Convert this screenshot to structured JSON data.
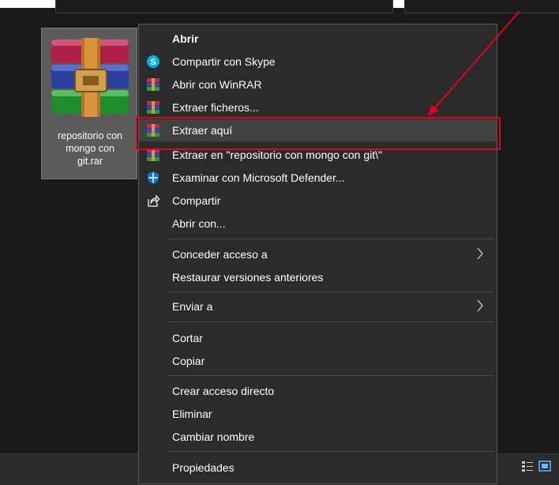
{
  "file": {
    "name": "repositorio con\nmongo con\ngit.rar",
    "icon": "winrar-archive-icon"
  },
  "menu": {
    "items": [
      {
        "label": "Abrir",
        "icon": ""
      },
      {
        "label": "Compartir con Skype",
        "icon": "skype-icon"
      },
      {
        "label": "Abrir con WinRAR",
        "icon": "winrar-icon"
      },
      {
        "label": "Extraer ficheros...",
        "icon": "winrar-icon"
      },
      {
        "label": "Extraer aquí",
        "icon": "winrar-icon"
      },
      {
        "label": "Extraer en \"repositorio con mongo con git\\\"",
        "icon": "winrar-icon"
      },
      {
        "label": "Examinar con Microsoft Defender...",
        "icon": "defender-shield-icon"
      },
      {
        "label": "Compartir",
        "icon": "share-icon"
      },
      {
        "label": "Abrir con...",
        "icon": ""
      },
      {
        "label": "Conceder acceso a",
        "icon": ""
      },
      {
        "label": "Restaurar versiones anteriores",
        "icon": ""
      },
      {
        "label": "Enviar a",
        "icon": ""
      },
      {
        "label": "Cortar",
        "icon": ""
      },
      {
        "label": "Copiar",
        "icon": ""
      },
      {
        "label": "Crear acceso directo",
        "icon": ""
      },
      {
        "label": "Eliminar",
        "icon": ""
      },
      {
        "label": "Cambiar nombre",
        "icon": ""
      },
      {
        "label": "Propiedades",
        "icon": ""
      }
    ]
  },
  "colors": {
    "annotation": "#e3001b",
    "menu_bg": "#2b2b2b",
    "hover_bg": "#414141",
    "skype": "#00aff0",
    "defender": "#0078d4"
  }
}
